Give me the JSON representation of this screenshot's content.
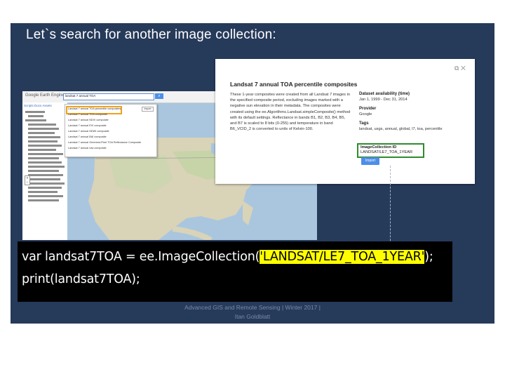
{
  "slide": {
    "title": "Let`s search for another image collection:",
    "background_color": "#263a5a"
  },
  "earth_engine": {
    "logo": "Google Earth Engine",
    "search_query": "landsat 7 annual TOA",
    "search_button_icon": "search-icon",
    "left_tabs": "Scripts  Docs  Assets",
    "dropdown": {
      "import_label": "Import",
      "rows": [
        "Landsat 7 annual TOA percentile composites",
        "Landsat 7 annual TOA composite",
        "Landsat 7 annual NDVI composite",
        "Landsat 7 annual EVI composite",
        "Landsat 7 annual NDWI composite",
        "Landsat 7 annual BAI composite",
        "Landsat 7 annual Greenest-Pixel TOA Reflectance Composite",
        "Landsat 7 annual raw composite"
      ]
    }
  },
  "dataset_dialog": {
    "title": "Landsat 7 annual TOA percentile composites",
    "description": "These 1-year composites were created from all Landsat 7 images in the specified composite period, excluding images marked with a negative sun elevation in their metadata. The composites were created using the ee.Algorithms.Landsat.simpleComposite() method with its default settings. Reflectance in bands B1, B2, B3, B4, B5, and B7 is scaled to 8 bits (0-255) and temperature in band B6_VCID_2 is converted to units of Kelvin-100.",
    "availability_label": "Dataset availability (time)",
    "availability_value": "Jan 1, 1999 - Dec 31, 2014",
    "provider_label": "Provider",
    "provider_value": "Google",
    "tags_label": "Tags",
    "tags_value": "landsat, usgs, annual, global, l7, toa, percentile",
    "collection_id_label": "ImageCollection ID",
    "collection_id_value": "LANDSAT/LE7_TOA_1YEAR",
    "import_button": "Import",
    "icons": [
      "open-external-icon",
      "close-icon"
    ]
  },
  "code": {
    "line1_prefix": "var landsat7TOA = ee.ImageCollection(",
    "line1_arg": "'LANDSAT/LE7_TOA_1YEAR'",
    "line1_suffix": ");",
    "line2": "print(landsat7TOA);",
    "highlight_color": "#ffff00"
  },
  "footer": {
    "line1": "Advanced GIS and Remote Sensing | Winter 2017 |",
    "line2": "Itan Goldblatt"
  }
}
